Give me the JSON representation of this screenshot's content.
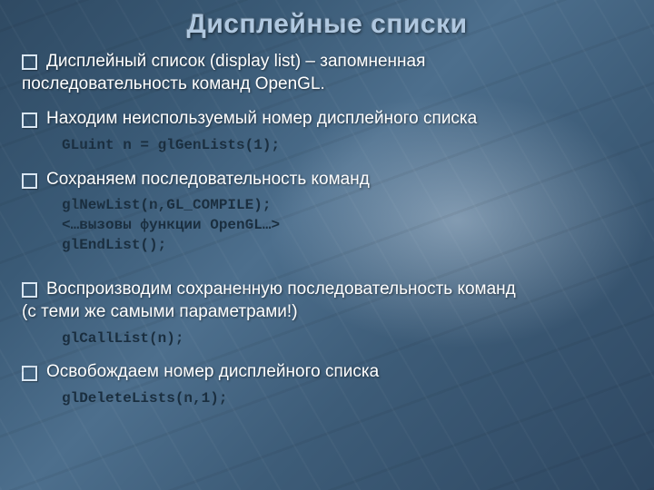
{
  "title": "Дисплейные списки",
  "bullets": {
    "b1_line1": " Дисплейный список (display list) – запомненная",
    "b1_line2": "последовательность команд OpenGL.",
    "b2": " Находим неиспользуемый номер дисплейного списка",
    "b3": " Сохраняем последовательность команд",
    "b4_line1": " Воспроизводим сохраненную последовательность команд",
    "b4_line2": "(с теми же самыми параметрами!)",
    "b5": " Освобождаем номер дисплейного списка"
  },
  "code": {
    "c1": "GLuint n = glGenLists(1);",
    "c2": "glNewList(n,GL_COMPILE);\n<…вызовы функции OpenGL…>\nglEndList();",
    "c3": "glCallList(n);",
    "c4": "glDeleteLists(n,1);"
  }
}
